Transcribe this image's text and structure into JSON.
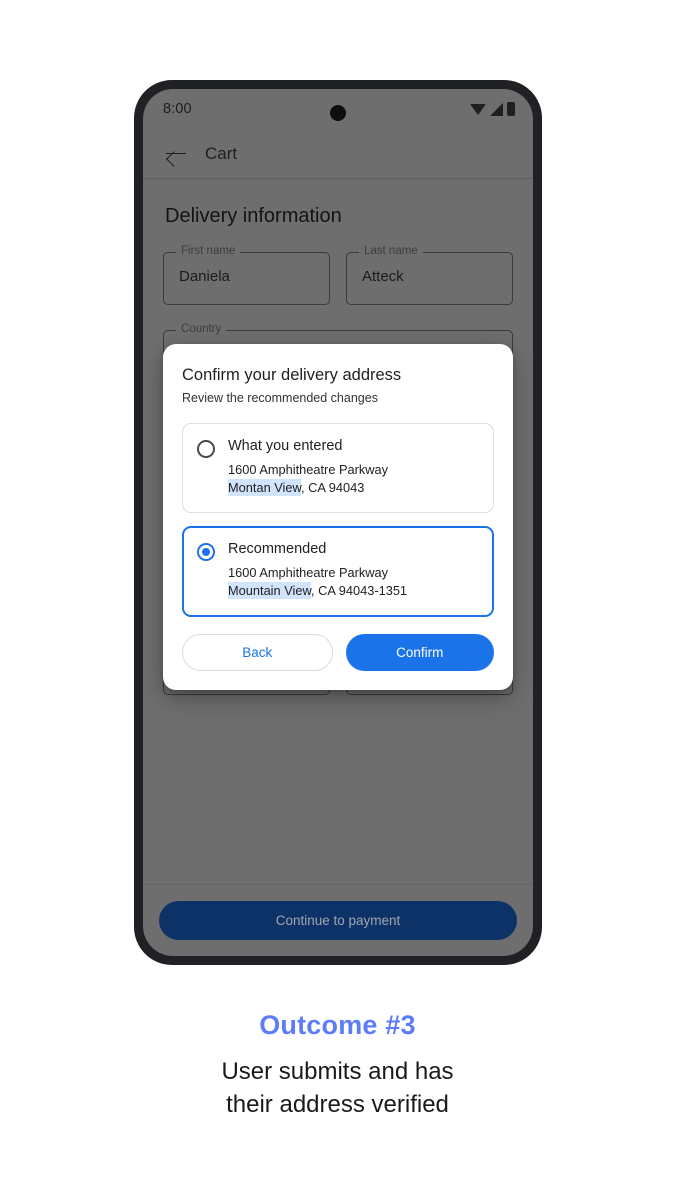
{
  "phone": {
    "status_bar": {
      "time": "8:00",
      "icons": [
        "wifi-icon",
        "signal-icon",
        "battery-icon"
      ]
    },
    "app_bar": {
      "back_icon": "back-arrow-icon",
      "title": "Cart"
    },
    "form": {
      "section_title": "Delivery information",
      "fields": [
        {
          "label": "First name",
          "value": "Daniela"
        },
        {
          "label": "Last name",
          "value": "Atteck"
        },
        {
          "label": "Country",
          "value": ""
        },
        {
          "label": "",
          "value": ""
        },
        {
          "label": "",
          "value": ""
        },
        {
          "label": "",
          "value": ""
        },
        {
          "label": "",
          "value": ""
        },
        {
          "label": "",
          "value": ""
        }
      ]
    },
    "cta": {
      "label": "Continue to payment"
    }
  },
  "dialog": {
    "title": "Confirm your delivery address",
    "subtitle": "Review the recommended changes",
    "options": [
      {
        "title": "What you entered",
        "line1": "1600 Amphitheatre Parkway",
        "line2_highlight": "Montan View",
        "line2_rest": ", CA 94043",
        "selected": false,
        "radio_icon": "radio-unchecked-icon"
      },
      {
        "title": "Recommended",
        "line1": "1600 Amphitheatre Parkway",
        "line2_highlight": "Mountain View",
        "line2_rest": ", CA 94043-1351",
        "selected": true,
        "radio_icon": "radio-checked-icon"
      }
    ],
    "actions": {
      "back_label": "Back",
      "confirm_label": "Confirm"
    }
  },
  "caption": {
    "title": "Outcome #3",
    "line1": "User submits and has",
    "line2": "their address verified"
  },
  "colors": {
    "accent_blue": "#1a73e8",
    "caption_blue": "#5c7cfa",
    "highlight_blue": "#d2e3fc",
    "cta_navy": "#0d3268",
    "scrim_grey": "#6e6e6e",
    "frame_dark": "#202124"
  }
}
